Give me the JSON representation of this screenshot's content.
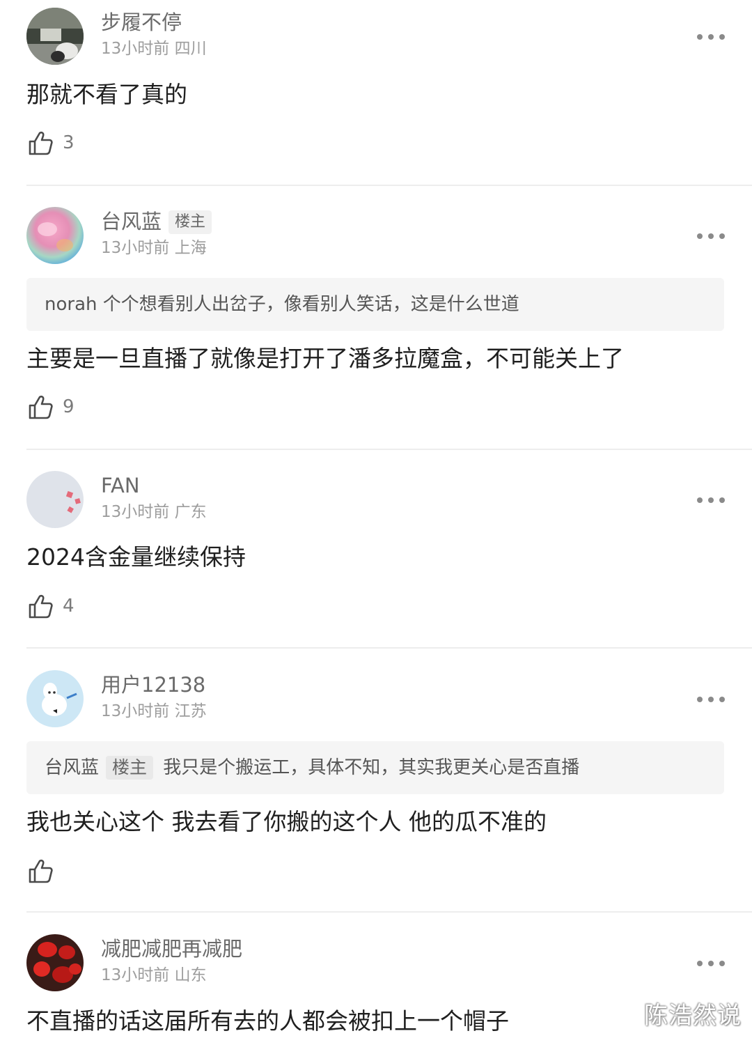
{
  "comments": [
    {
      "username": "步履不停",
      "meta": "13小时前 四川",
      "text": "那就不看了真的",
      "likes": "3",
      "is_op": false
    },
    {
      "username": "台风蓝",
      "badge": "楼主",
      "meta": "13小时前 上海",
      "quote": {
        "author": "norah",
        "text": "个个想看别人出岔子，像看别人笑话，这是什么世道"
      },
      "text": "主要是一旦直播了就像是打开了潘多拉魔盒，不可能关上了",
      "likes": "9",
      "is_op": true
    },
    {
      "username": "FAN",
      "meta": "13小时前 广东",
      "text": "2024含金量继续保持",
      "likes": "4",
      "is_op": false
    },
    {
      "username": "用户12138",
      "meta": "13小时前 江苏",
      "quote": {
        "author": "台风蓝",
        "badge": "楼主",
        "text": "我只是个搬运工，具体不知，其实我更关心是否直播"
      },
      "text": "我也关心这个 我去看了你搬的这个人 他的瓜不准的",
      "likes": "",
      "is_op": false
    },
    {
      "username": "减肥减肥再减肥",
      "meta": "13小时前 山东",
      "text": "不直播的话这届所有去的人都会被扣上一个帽子",
      "is_op": false
    }
  ],
  "icons": {
    "like": "thumbs-up-icon",
    "more": "more-dots-icon"
  },
  "watermark": "陈浩然说",
  "colors": {
    "username": "#6a6a6a",
    "meta": "#9d9d9d",
    "quote_bg": "#f5f5f5",
    "divider": "#ededed"
  }
}
